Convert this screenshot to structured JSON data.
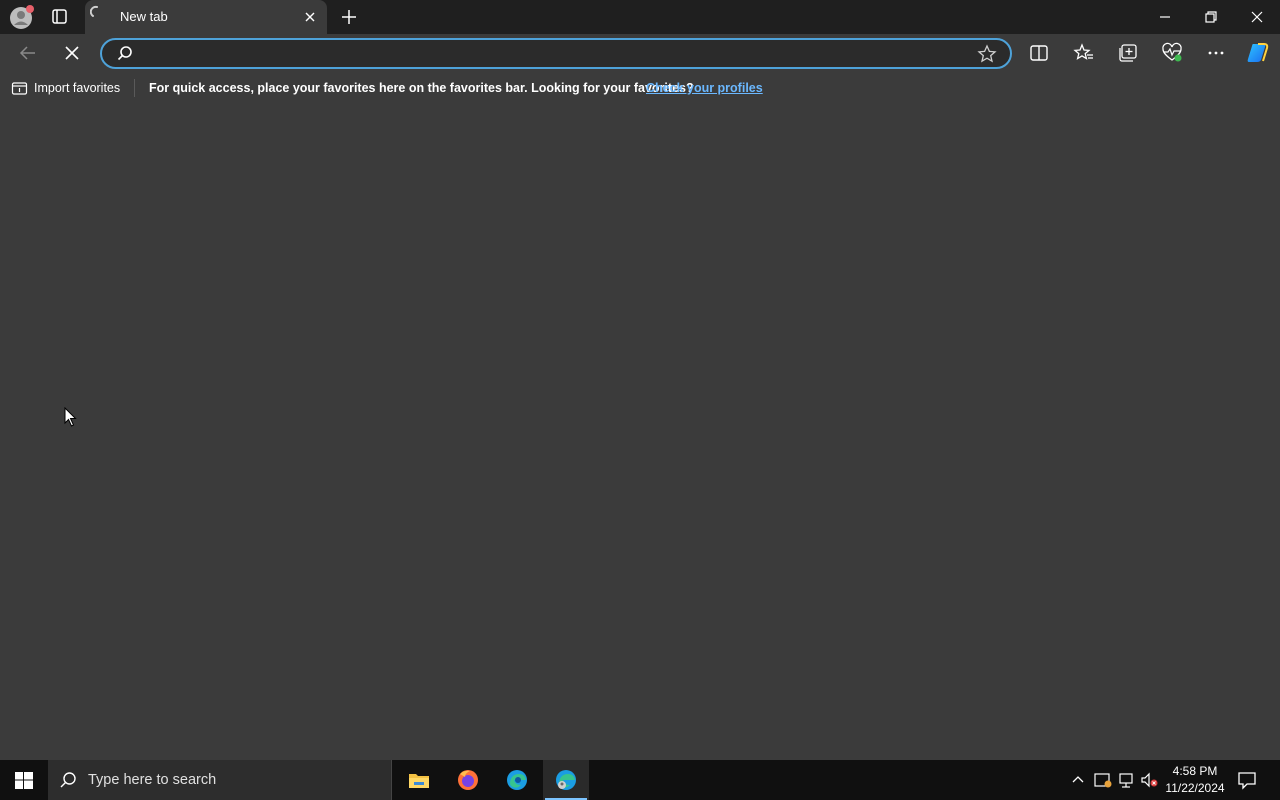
{
  "browser": {
    "tab_title": "New tab",
    "address": {
      "value": "",
      "placeholder": ""
    },
    "icons": {
      "profile": "profile-avatar-icon",
      "tab_actions": "tab-actions-icon",
      "loading": "loading-spinner-icon",
      "close_tab": "close-icon",
      "new_tab": "plus-icon",
      "back": "back-arrow-icon",
      "stop": "stop-icon",
      "search": "search-icon",
      "favorite": "star-icon",
      "split_screen": "split-screen-icon",
      "favorites": "favorites-icon",
      "collections": "collections-icon",
      "browser_essentials": "heart-pulse-icon",
      "more": "more-icon",
      "copilot": "copilot-icon"
    }
  },
  "favorites_bar": {
    "import_label": "Import favorites",
    "message": "For quick access, place your favorites here on the favorites bar. Looking for your favorites?",
    "link": "Check your profiles"
  },
  "taskbar": {
    "search_placeholder": "Type here to search",
    "time": "4:58 PM",
    "date": "11/22/2024",
    "apps": [
      "file-explorer-icon",
      "firefox-icon",
      "edge-icon",
      "edge-dev-icon"
    ]
  },
  "colors": {
    "accent": "#4ea2d9",
    "link": "#6bb8ff",
    "background": "#3b3b3b",
    "titlebar": "#1f1f1f",
    "taskbar": "#101010"
  }
}
